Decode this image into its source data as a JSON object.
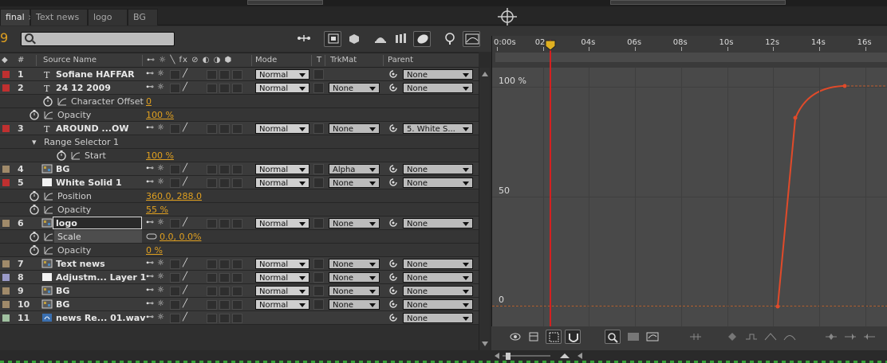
{
  "tabs": [
    {
      "label": "final",
      "active": true,
      "closable": true
    },
    {
      "label": "Text news",
      "active": false
    },
    {
      "label": "logo",
      "active": false
    },
    {
      "label": "BG",
      "active": false
    }
  ],
  "timecode": "9",
  "search": {
    "placeholder": "",
    "value": ""
  },
  "columns": {
    "num": "#",
    "source": "Source Name",
    "mode": "Mode",
    "t": "T",
    "trkmat": "TrkMat",
    "parent": "Parent"
  },
  "rows": [
    {
      "kind": "layer",
      "num": "1",
      "name": "Sofiane HAFFAR",
      "label_color": "#c03030",
      "icon": "text-layer-icon",
      "mode": "Normal",
      "trkmat": "",
      "parent": "None"
    },
    {
      "kind": "layer",
      "num": "2",
      "name": "24 12 2009",
      "label_color": "#c03030",
      "icon": "text-layer-icon",
      "mode": "Normal",
      "trkmat": "None",
      "parent": "None"
    },
    {
      "kind": "prop",
      "name": "Character Offset",
      "value": "0",
      "indent": 1
    },
    {
      "kind": "prop",
      "name": "Opacity",
      "value": "100 %",
      "indent": 0
    },
    {
      "kind": "layer",
      "num": "3",
      "name": "AROUND ...OW",
      "label_color": "#c03030",
      "icon": "text-layer-icon",
      "mode": "Normal",
      "trkmat": "None",
      "parent": "5. White S..."
    },
    {
      "kind": "group",
      "name": "Range Selector 1"
    },
    {
      "kind": "prop",
      "name": "Start",
      "value": "100 %",
      "indent": 2
    },
    {
      "kind": "layer",
      "num": "4",
      "name": "BG",
      "label_color": "#a08a6a",
      "icon": "comp-layer-icon",
      "mode": "Normal",
      "trkmat": "Alpha",
      "parent": "None"
    },
    {
      "kind": "layer",
      "num": "5",
      "name": "White Solid 1",
      "label_color": "#c03030",
      "icon": "solid-layer-icon",
      "mode": "Normal",
      "trkmat": "None",
      "parent": "None"
    },
    {
      "kind": "prop",
      "name": "Position",
      "value": "360.0, 288.0",
      "indent": 0
    },
    {
      "kind": "prop",
      "name": "Opacity",
      "value": "55 %",
      "indent": 0
    },
    {
      "kind": "layer",
      "num": "6",
      "name": "logo",
      "label_color": "#a08a6a",
      "icon": "comp-layer-icon",
      "mode": "Normal",
      "trkmat": "None",
      "parent": "None",
      "selected": true
    },
    {
      "kind": "prop",
      "name": "Scale",
      "value": "0.0, 0.0%",
      "indent": 0,
      "highlight": true
    },
    {
      "kind": "prop",
      "name": "Opacity",
      "value": "0 %",
      "indent": 0
    },
    {
      "kind": "layer",
      "num": "7",
      "name": "Text news",
      "label_color": "#a08a6a",
      "icon": "comp-layer-icon",
      "mode": "Normal",
      "trkmat": "None",
      "parent": "None"
    },
    {
      "kind": "layer",
      "num": "8",
      "name": "Adjustm... Layer 1",
      "label_color": "#9a9ac8",
      "icon": "solid-layer-icon",
      "mode": "Normal",
      "trkmat": "None",
      "parent": "None"
    },
    {
      "kind": "layer",
      "num": "9",
      "name": "BG",
      "label_color": "#a08a6a",
      "icon": "comp-layer-icon",
      "mode": "Normal",
      "trkmat": "None",
      "parent": "None"
    },
    {
      "kind": "layer",
      "num": "10",
      "name": "BG",
      "label_color": "#a08a6a",
      "icon": "comp-layer-icon",
      "mode": "Normal",
      "trkmat": "None",
      "parent": "None"
    },
    {
      "kind": "layer",
      "num": "11",
      "name": "news Re... 01.wav",
      "label_color": "#a0c0a0",
      "icon": "audio-layer-icon",
      "mode": "",
      "trkmat": "",
      "parent": "None"
    }
  ],
  "ruler": {
    "ticks": [
      "0:00s",
      "02s",
      "04s",
      "06s",
      "08s",
      "10s",
      "12s",
      "14s",
      "16s"
    ]
  },
  "graph": {
    "y_labels": [
      "100 %",
      "50",
      "0"
    ]
  },
  "colors": {
    "accent": "#e0a020",
    "playhead": "#d42020",
    "curve": "#e04a2a"
  }
}
